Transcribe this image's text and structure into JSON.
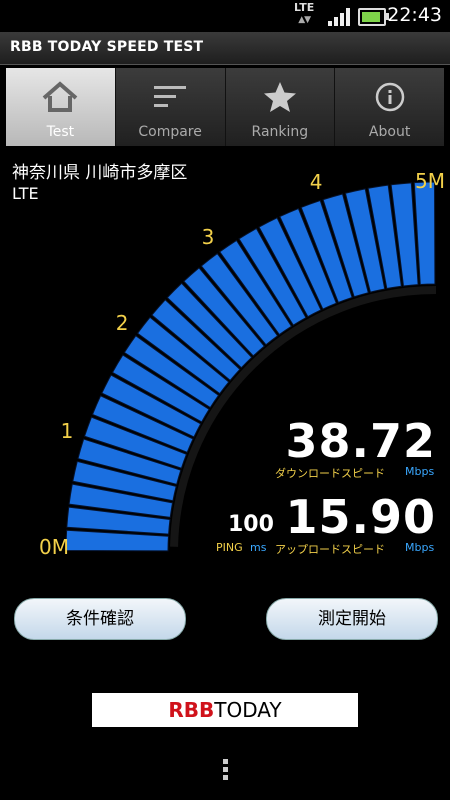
{
  "status_bar": {
    "network": "LTE",
    "time": "22:43"
  },
  "app": {
    "title": "RBB TODAY SPEED TEST"
  },
  "tabs": [
    {
      "label": "Test",
      "icon": "home-icon",
      "active": true
    },
    {
      "label": "Compare",
      "icon": "list-icon",
      "active": false
    },
    {
      "label": "Ranking",
      "icon": "star-icon",
      "active": false
    },
    {
      "label": "About",
      "icon": "info-icon",
      "active": false
    }
  ],
  "location": "神奈川県 川崎市多摩区",
  "network": "LTE",
  "gauge": {
    "tick_labels": [
      "0M",
      "1",
      "2",
      "3",
      "4",
      "5M"
    ],
    "max": 5,
    "level": 5
  },
  "download": {
    "value": "38.72",
    "label": "ダウンロードスピード",
    "unit": "Mbps"
  },
  "upload": {
    "value": "15.90",
    "label": "アップロードスピード",
    "unit": "Mbps"
  },
  "ping": {
    "value": "100",
    "label": "PING",
    "unit": "ms"
  },
  "buttons": {
    "conditions": "条件確認",
    "start": "測定開始"
  },
  "brand": {
    "prefix": "RBB",
    "suffix": "TODAY"
  },
  "colors": {
    "gauge_blue": "#1a6fe0",
    "label_yellow": "#f2d04a",
    "unit_blue": "#3aa8ff"
  }
}
